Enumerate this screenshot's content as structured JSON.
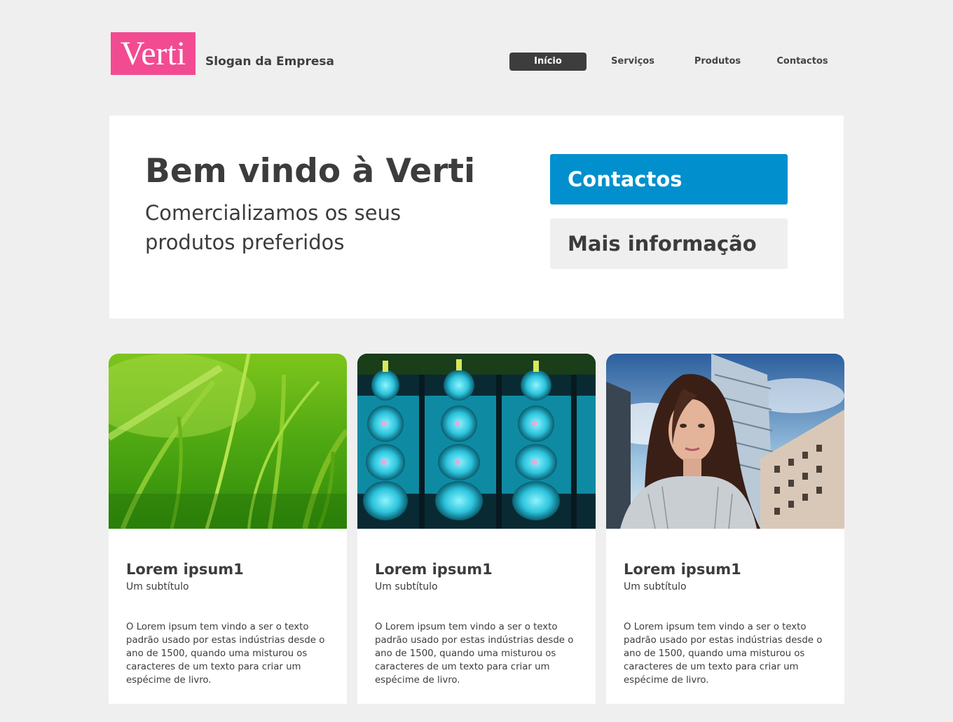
{
  "header": {
    "logo_text": "Verti",
    "slogan": "Slogan da Empresa"
  },
  "nav": {
    "items": [
      {
        "label": "Início",
        "active": true
      },
      {
        "label": "Serviços",
        "active": false
      },
      {
        "label": "Produtos",
        "active": false
      },
      {
        "label": "Contactos",
        "active": false
      }
    ]
  },
  "hero": {
    "title": "Bem vindo à Verti",
    "subtitle": "Comercializamos os seus produtos preferidos",
    "contact_button": "Contactos",
    "more_button": "Mais informação"
  },
  "cards": [
    {
      "image": "grass-photo",
      "title": "Lorem ipsum1",
      "subtitle": "Um subtítulo",
      "text": "O Lorem ipsum tem vindo a ser o texto padrão usado por estas indústrias desde o ano de 1500, quando uma misturou os caracteres de um texto para criar um espécime de livro."
    },
    {
      "image": "light-bulbs-photo",
      "title": "Lorem ipsum1",
      "subtitle": "Um subtítulo",
      "text": "O Lorem ipsum tem vindo a ser o texto padrão usado por estas indústrias desde o ano de 1500, quando uma misturou os caracteres de um texto para criar um espécime de livro."
    },
    {
      "image": "businesswoman-city-photo",
      "title": "Lorem ipsum1",
      "subtitle": "Um subtítulo",
      "text": "O Lorem ipsum tem vindo a ser o texto padrão usado por estas indústrias desde o ano de 1500, quando uma misturou os caracteres de um texto para criar um espécime de livro."
    }
  ],
  "colors": {
    "logo_background": "#f24b92",
    "primary_button": "#0190cd",
    "nav_active": "#3d3d3d",
    "page_background": "#efefef"
  }
}
